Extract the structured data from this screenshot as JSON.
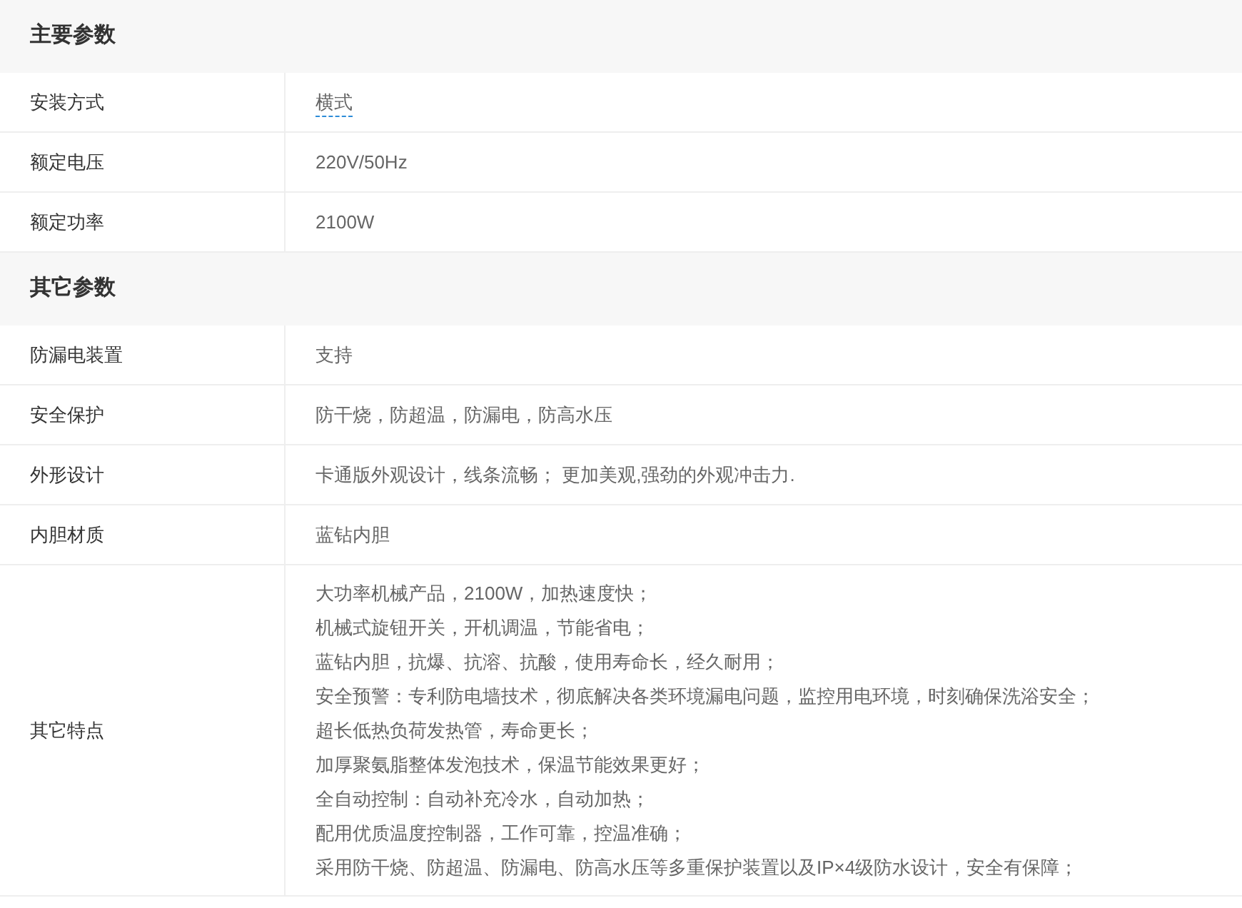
{
  "sections": [
    {
      "title": "主要参数",
      "rows": [
        {
          "label": "安装方式",
          "lines": [
            "横式"
          ],
          "underlined": true
        },
        {
          "label": "额定电压",
          "lines": [
            "220V/50Hz"
          ],
          "underlined": false
        },
        {
          "label": "额定功率",
          "lines": [
            "2100W"
          ],
          "underlined": false
        }
      ]
    },
    {
      "title": "其它参数",
      "rows": [
        {
          "label": "防漏电装置",
          "lines": [
            "支持"
          ],
          "underlined": false
        },
        {
          "label": "安全保护",
          "lines": [
            "防干烧，防超温，防漏电，防高水压"
          ],
          "underlined": false
        },
        {
          "label": "外形设计",
          "lines": [
            "卡通版外观设计，线条流畅； 更加美观,强劲的外观冲击力."
          ],
          "underlined": false
        },
        {
          "label": "内胆材质",
          "lines": [
            "蓝钻内胆"
          ],
          "underlined": false
        },
        {
          "label": "其它特点",
          "lines": [
            "大功率机械产品，2100W，加热速度快；",
            "机械式旋钮开关，开机调温，节能省电；",
            "蓝钻内胆，抗爆、抗溶、抗酸，使用寿命长，经久耐用；",
            "安全预警：专利防电墙技术，彻底解决各类环境漏电问题，监控用电环境，时刻确保洗浴安全；",
            "超长低热负荷发热管，寿命更长；",
            "加厚聚氨脂整体发泡技术，保温节能效果更好；",
            "全自动控制：自动补充冷水，自动加热；",
            "配用优质温度控制器，工作可靠，控温准确；",
            "采用防干烧、防超温、防漏电、防高水压等多重保护装置以及IP×4级防水设计，安全有保障；"
          ],
          "underlined": false
        }
      ]
    }
  ]
}
